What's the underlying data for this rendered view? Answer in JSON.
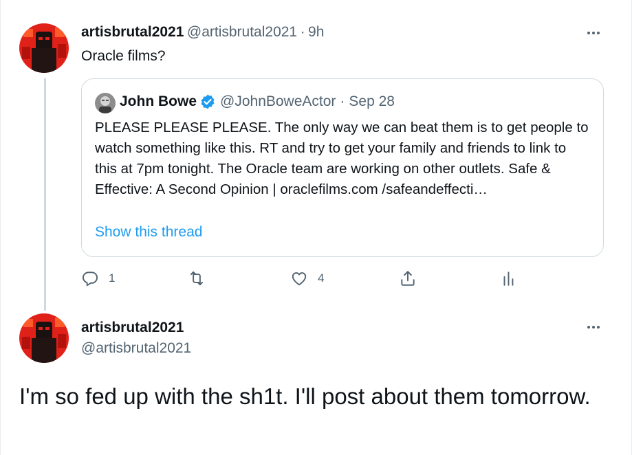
{
  "reply_tweet": {
    "display_name": "artisbrutal2021",
    "handle": "@artisbrutal2021",
    "separator": "·",
    "time": "9h",
    "text": "Oracle films?",
    "more_icon": "more-horizontal-icon"
  },
  "quoted_tweet": {
    "display_name": "John Bowe",
    "verified_icon": "verified-badge-icon",
    "handle": "@JohnBoweActor",
    "separator": "·",
    "date": "Sep 28",
    "text": "PLEASE PLEASE PLEASE. The only way we can beat them is to get people to watch something like this. RT and try to get your family and friends to link to this at 7pm tonight. The Oracle team are working on other outlets. Safe & Effective: A Second Opinion |  oraclefilms.com /safeandeffecti…",
    "show_thread_label": "Show this thread"
  },
  "actions": {
    "reply": {
      "icon": "reply-icon",
      "count": "1"
    },
    "retweet": {
      "icon": "retweet-icon",
      "count": ""
    },
    "like": {
      "icon": "heart-icon",
      "count": "4"
    },
    "share": {
      "icon": "share-icon"
    },
    "analytics": {
      "icon": "analytics-icon"
    }
  },
  "main_tweet": {
    "display_name": "artisbrutal2021",
    "handle": "@artisbrutal2021",
    "text": "I'm so fed up with the sh1t. I'll post about them tomorrow.",
    "more_icon": "more-horizontal-icon"
  },
  "colors": {
    "accent": "#1d9bf0",
    "text": "#0f1419",
    "muted": "#536471",
    "border": "#cfd9de",
    "avatar_red": "#e0211a"
  }
}
